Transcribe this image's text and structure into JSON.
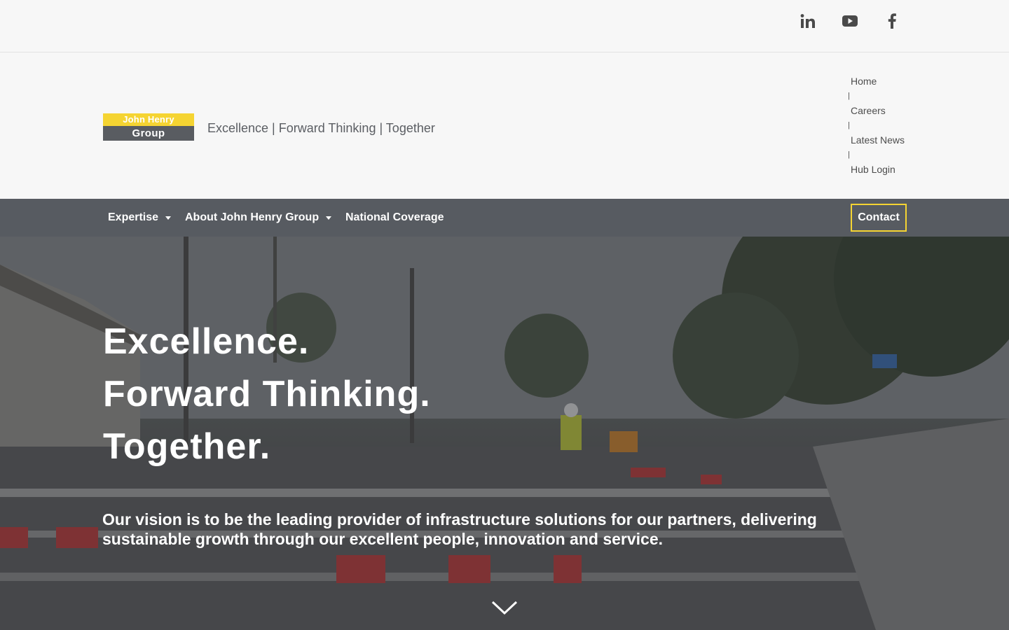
{
  "social": {
    "linkedin_icon": "linkedin-icon",
    "youtube_icon": "youtube-icon",
    "facebook_icon": "facebook-icon"
  },
  "header": {
    "logo_line1": "John Henry",
    "logo_line2": "Group",
    "tagline": "Excellence | Forward Thinking | Together",
    "utility_links": [
      "Home",
      "Careers",
      "Latest News",
      "Hub Login"
    ],
    "separator": "|"
  },
  "nav": {
    "items": [
      {
        "label": "Expertise",
        "has_dropdown": true
      },
      {
        "label": "About John Henry Group",
        "has_dropdown": true
      },
      {
        "label": "National Coverage",
        "has_dropdown": false
      }
    ],
    "contact_label": "Contact"
  },
  "hero": {
    "headline_lines": [
      "Excellence.",
      "Forward Thinking.",
      "Together."
    ],
    "vision": "Our vision is to be the leading provider of infrastructure solutions for our partners, delivering sustainable growth through our excellent people, innovation and service.",
    "scroll_icon": "chevron-down-icon"
  },
  "colors": {
    "brand_yellow": "#f5d432",
    "brand_grey": "#595c61",
    "nav_bg": "#575b61",
    "page_bg": "#f7f7f7"
  }
}
